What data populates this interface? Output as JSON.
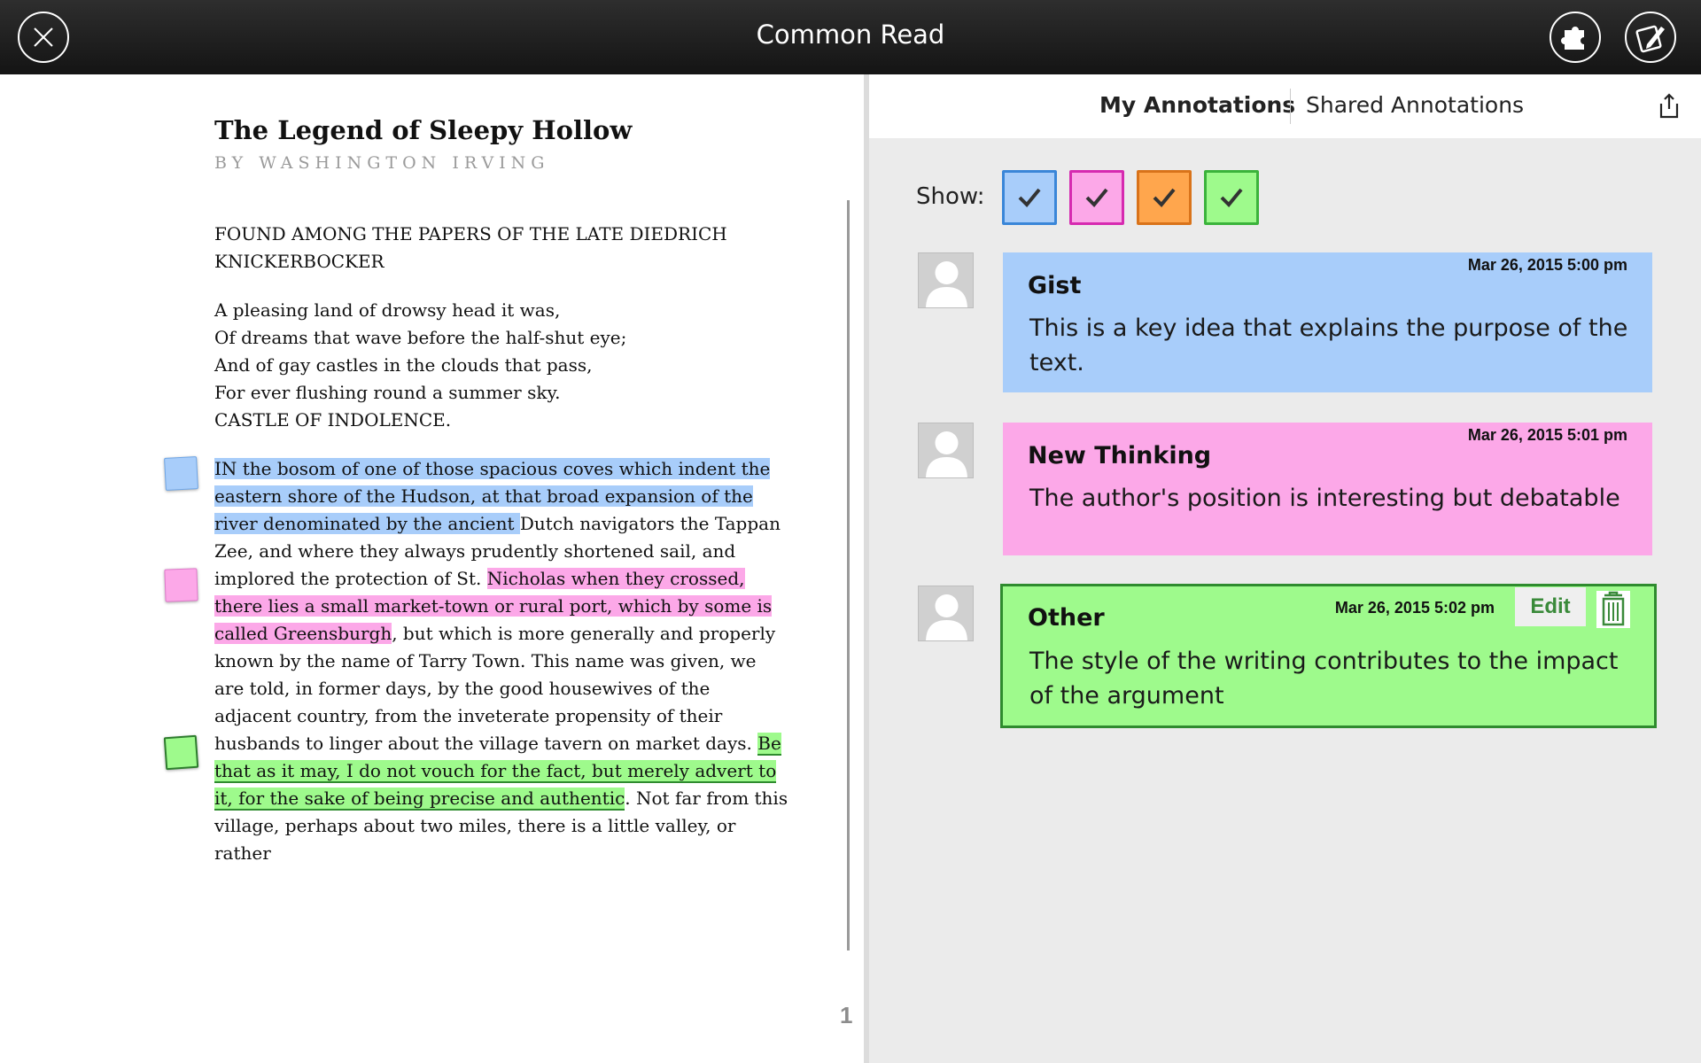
{
  "app": {
    "title": "Common Read"
  },
  "document": {
    "title": "The Legend of Sleepy Hollow",
    "author": "BY WASHINGTON IRVING",
    "heading": [
      "FOUND AMONG THE PAPERS OF THE LATE DIEDRICH",
      "KNICKERBOCKER"
    ],
    "poem": [
      "A pleasing land of drowsy head it was,",
      "Of dreams that wave before the half-shut eye;",
      "And of gay castles in the clouds that pass,",
      "For ever flushing round a summer sky.",
      "CASTLE OF INDOLENCE."
    ],
    "body": {
      "hl_blue": "IN the bosom of one of those spacious coves which indent the eastern shore of the Hudson, at that broad expansion of the river denominated by the ancient ",
      "text1": "Dutch navigators the Tappan Zee, and where they always prudently shortened sail, and implored the protection of St. ",
      "hl_pink": "Nicholas when they crossed, there lies a small market-town or rural port, which by some is called Greensburgh",
      "text2": ", but which is more generally and properly known by the name of Tarry Town. This name was given, we are told, in former days, by the good housewives of the adjacent country, from the inveterate propensity of their husbands to linger about the village tavern on market days. ",
      "hl_green": "Be that as it may, I do not vouch for the fact, but merely advert to it, for the sake of being precise and authentic",
      "text3": ". Not far from this village, perhaps about two miles, there is a little valley, or rather"
    },
    "page_number": "1"
  },
  "annotations_panel": {
    "tabs": {
      "active": "My Annotations",
      "inactive": "Shared Annotations"
    },
    "show_label": "Show:",
    "filters": [
      {
        "name": "blue",
        "color": "#a8cdfa",
        "border": "#3a86d8",
        "checked": true
      },
      {
        "name": "pink",
        "color": "#fca8e8",
        "border": "#d62ab0",
        "checked": true
      },
      {
        "name": "orange",
        "color": "#ffa64d",
        "border": "#d9731a",
        "checked": true
      },
      {
        "name": "green",
        "color": "#9efa8c",
        "border": "#3bb33b",
        "checked": true
      }
    ],
    "cards": [
      {
        "date": "Mar 26, 2015 5:00 pm",
        "tag": "Gist",
        "body": "This is a key idea that explains the purpose of the text.",
        "color": "#a8cdfa"
      },
      {
        "date": "Mar 26, 2015 5:01 pm",
        "tag": "New Thinking",
        "body": "The author's position is interesting but debatable",
        "color": "#fca8e8"
      },
      {
        "date": "Mar 26, 2015 5:02 pm",
        "tag": "Other",
        "body": "The style of the writing contributes to the impact of the argument",
        "color": "#9efa8c",
        "edit_label": "Edit"
      }
    ]
  }
}
